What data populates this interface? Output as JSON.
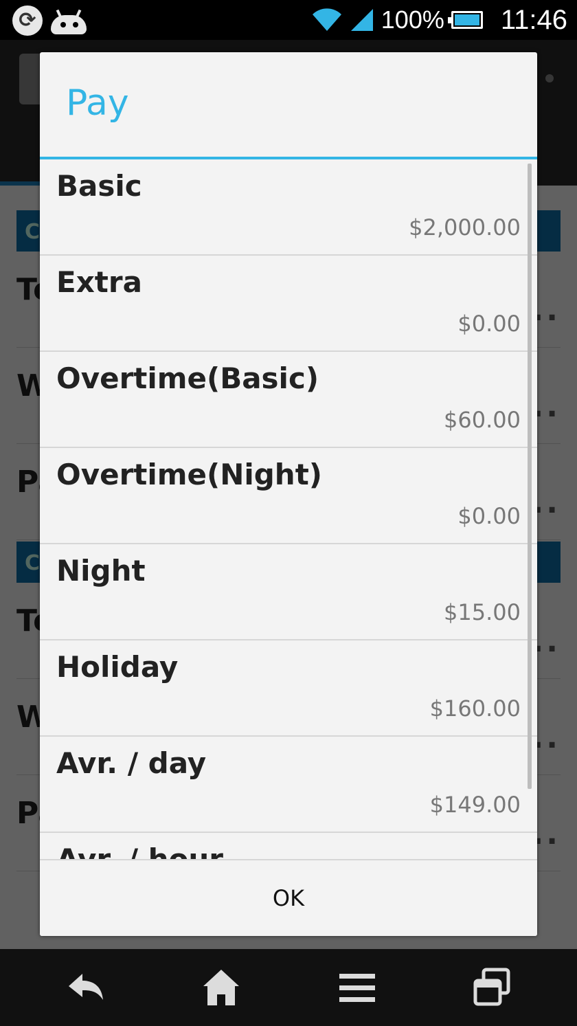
{
  "status_bar": {
    "battery_percent": "100%",
    "time": "11:46",
    "icons": [
      "sync-icon",
      "android-icon",
      "wifi-icon",
      "signal-icon",
      "battery-icon"
    ]
  },
  "background": {
    "section_label": "Co",
    "rows": [
      "Te",
      "W",
      "Pa",
      "Te",
      "W",
      "Pa"
    ],
    "dots": "..."
  },
  "dialog": {
    "title": "Pay",
    "items": [
      {
        "label": "Basic",
        "value": "$2,000.00"
      },
      {
        "label": "Extra",
        "value": "$0.00"
      },
      {
        "label": "Overtime(Basic)",
        "value": "$60.00"
      },
      {
        "label": "Overtime(Night)",
        "value": "$0.00"
      },
      {
        "label": "Night",
        "value": "$15.00"
      },
      {
        "label": "Holiday",
        "value": "$160.00"
      },
      {
        "label": "Avr. / day",
        "value": "$149.00"
      },
      {
        "label": "Avr. / hour",
        "value": ""
      }
    ],
    "ok_label": "OK"
  },
  "colors": {
    "accent": "#33b5e5",
    "section": "#0e6fa8"
  }
}
